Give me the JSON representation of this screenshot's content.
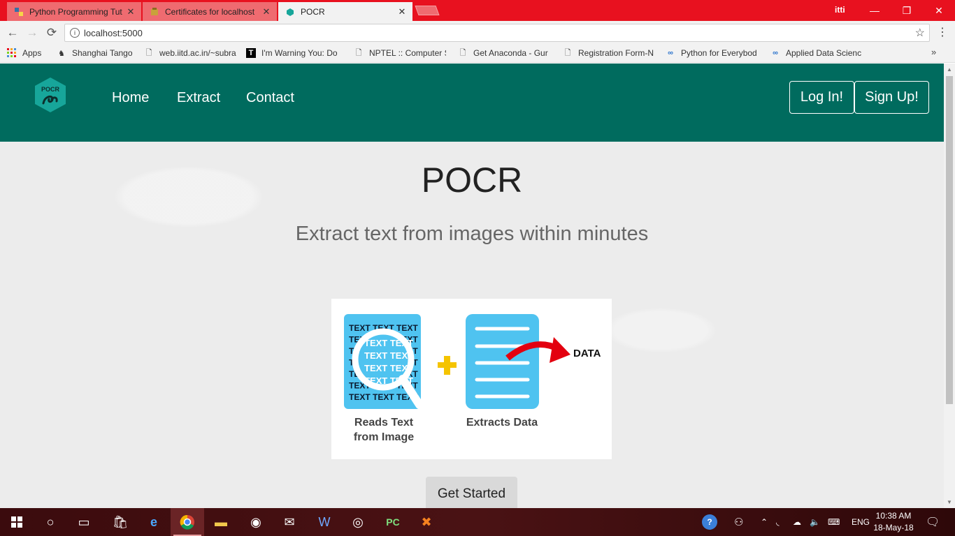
{
  "browser": {
    "tabs": [
      {
        "title": "Python Programming Tut",
        "icon": "python-icon"
      },
      {
        "title": "Certificates for localhost",
        "icon": "certificate-icon"
      },
      {
        "title": "POCR",
        "icon": "pocr-favicon"
      }
    ],
    "profile": "itti",
    "url": "localhost:5000",
    "bookmarks": [
      {
        "label": "Apps",
        "icon": "apps-grid-icon"
      },
      {
        "label": "Shanghai Tango",
        "icon": "site-icon"
      },
      {
        "label": "web.iitd.ac.in/~subra",
        "icon": "page-icon"
      },
      {
        "label": "I'm Warning You: Do",
        "icon": "t-logo-icon"
      },
      {
        "label": "NPTEL :: Computer S",
        "icon": "page-icon"
      },
      {
        "label": "Get Anaconda - Gur",
        "icon": "page-icon"
      },
      {
        "label": "Registration Form-N",
        "icon": "page-icon"
      },
      {
        "label": "Python for Everybod",
        "icon": "coursera-icon"
      },
      {
        "label": "Applied Data Scienc",
        "icon": "coursera-icon"
      }
    ]
  },
  "site": {
    "logo_text": "POCR",
    "nav": [
      "Home",
      "Extract",
      "Contact"
    ],
    "login": "Log In!",
    "signup": "Sign Up!",
    "title": "POCR",
    "subtitle": "Extract text from images within minutes",
    "illustration": {
      "text_word": "TEXT",
      "data_label": "DATA",
      "caption_left_1": "Reads Text",
      "caption_left_2": "from Image",
      "caption_right": "Extracts Data"
    },
    "cta": "Get Started",
    "colors": {
      "navbar": "#006b5e",
      "doc_blue": "#4fc3f0",
      "plus_yellow": "#f5c400",
      "arrow_red": "#e3000f"
    }
  },
  "taskbar": {
    "language": "ENG",
    "time": "10:38 AM",
    "date": "18-May-18"
  }
}
